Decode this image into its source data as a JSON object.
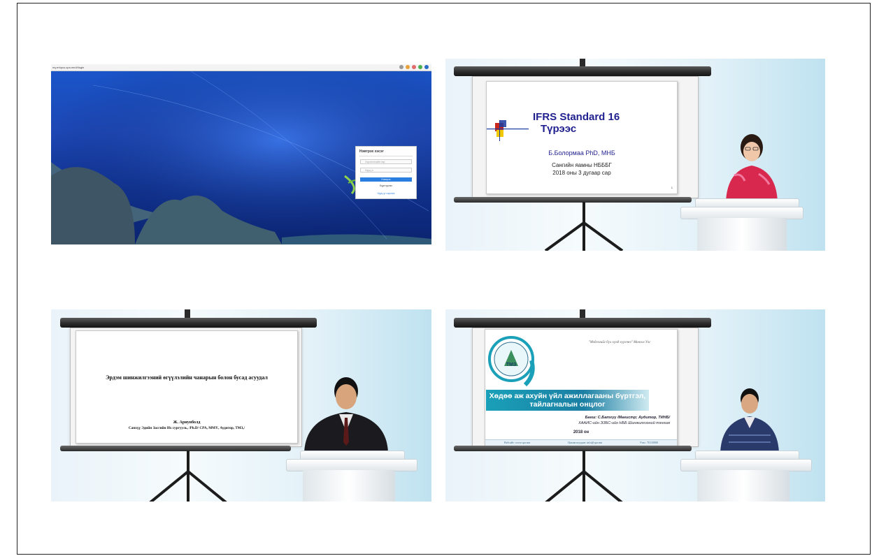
{
  "panels": {
    "browser": {
      "url": "my.erkpcu.cpa.mn/#/login",
      "login": {
        "title": "Нэвтрэх хэсэг",
        "username_placeholder": "Хэрэглэгчийн нэр",
        "password_placeholder": "Нууц үг",
        "login_button": "Нэвтрэх",
        "register_label": "Бүртгүүлэх",
        "forgot_label": "Нууц үг сэргээх"
      }
    },
    "ifrs": {
      "title": "IFRS Standard 16",
      "subtitle": "Түрээс",
      "author": "Б.Болормаа PhD, МНБ",
      "org": "Сангийн яамны НБББГ",
      "date": "2018 оны 3 дугаар сар",
      "page": "1"
    },
    "research": {
      "title": "Эрдэм шинжилгээний өгүүлэлийн чанарын болон бусад асуудал",
      "author": "Ж. Ариунболд",
      "credentials": "Санхүү Эдийн Засгийн Их сургууль, /Ph.D/ CPA, ММҮ, Аудитор, ТМЗ,/"
    },
    "rural": {
      "quote": "\"Мэдлэгийг бүх хүнд хүргэнэ\" Монгол Улс",
      "logo_text": "ТМЗ",
      "banner": "Хөдөө аж ахуйн үйл ажиллагааны бүртгэл, тайлагналын онцлог",
      "teacher": "Багш: С.Батхүү /Магистр; Аудитор, ТИНБ/",
      "teacher_org": "ХААИС-ийн ЭЗБС-ийн НББ Шинжилгээний тэнхим",
      "year": "2018 он",
      "footer": [
        "Вэбсайт: www.cpa.mn",
        "Цахим шуудан: info@cpa.mn",
        "Утас: 70110000"
      ]
    }
  }
}
